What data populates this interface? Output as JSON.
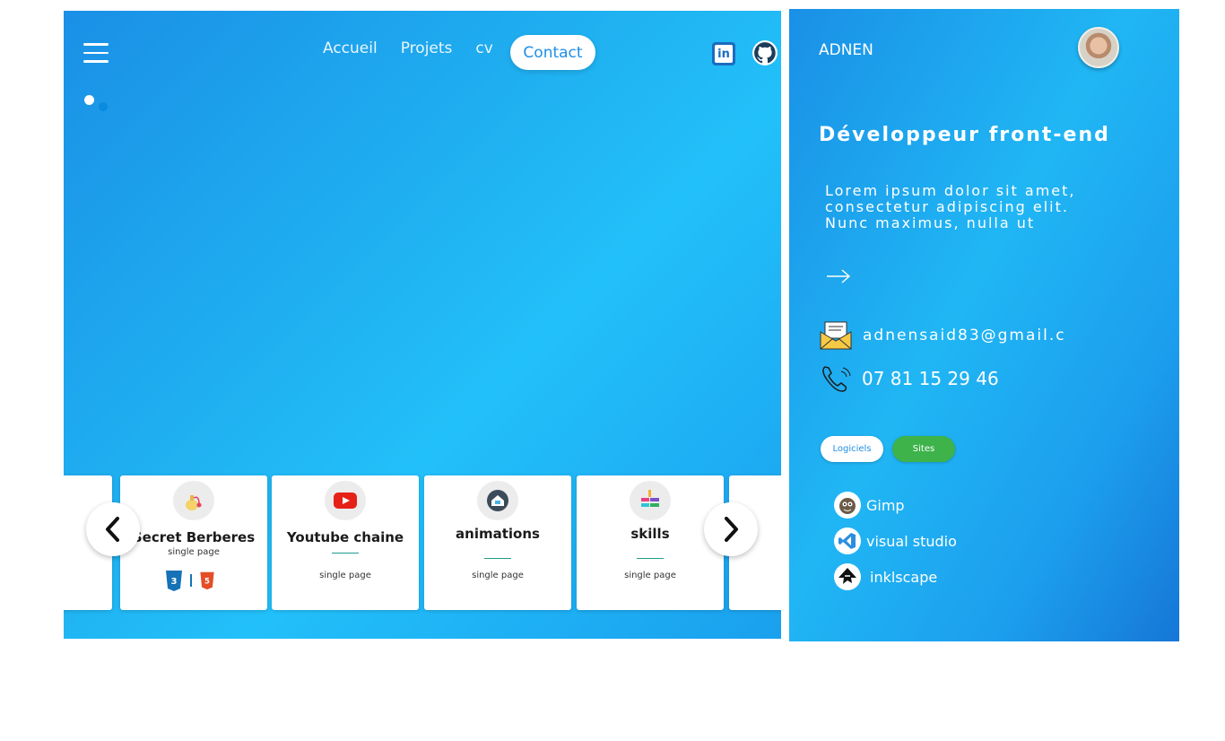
{
  "nav": {
    "items": [
      "Accueil",
      "Projets",
      "cv"
    ],
    "contact_label": "Contact"
  },
  "cards": [
    {
      "title": "Secret Berberes",
      "subtitle": "single page",
      "icon": "perfume-icon",
      "tech": [
        "css3-icon",
        "html5-icon"
      ]
    },
    {
      "title": "Youtube chaine",
      "subtitle": "single page",
      "icon": "youtube-icon"
    },
    {
      "title": "animations",
      "subtitle": "single page",
      "icon": "house-icon"
    },
    {
      "title": "skills",
      "subtitle": "single page",
      "icon": "skills-icon"
    }
  ],
  "profile": {
    "name": "ADNEN",
    "role": "Développeur front-end",
    "bio": "Lorem ipsum dolor sit amet, consectetur adipiscing elit. Nunc maximus, nulla ut",
    "email": "adnensaid83@gmail.c",
    "phone": "07 81 15 29 46"
  },
  "tabs": {
    "software": "Logiciels",
    "sites": "Sites"
  },
  "software": [
    "Gimp",
    "visual studio",
    "inklscape"
  ],
  "colors": {
    "panel_blue": "#20b4f2",
    "sites_green": "#3db34a",
    "contact_text": "#1d8fe6"
  }
}
